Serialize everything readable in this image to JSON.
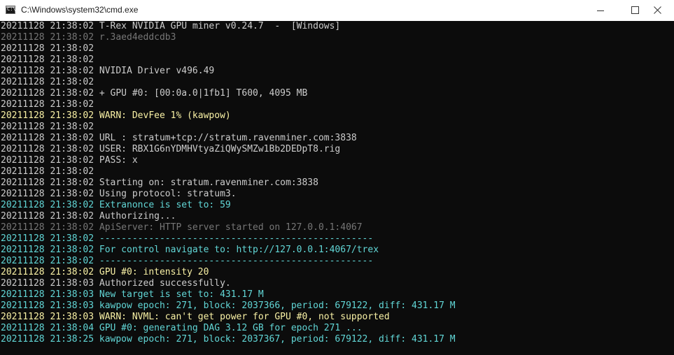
{
  "window": {
    "title": "C:\\Windows\\system32\\cmd.exe",
    "icon": "cmd-icon",
    "icon_text": "C:\\",
    "controls": [
      "minimize-icon",
      "maximize-icon",
      "close-icon"
    ]
  },
  "colors": {
    "background": "#0c0c0c",
    "default": "#cccccc",
    "dim": "#767676",
    "warn": "#f9f1a5",
    "info": "#61d6d6"
  },
  "lines": [
    {
      "text": "20211128 21:38:02 T-Rex NVIDIA GPU miner v0.24.7  -  [Windows]",
      "color": "white"
    },
    {
      "text": "20211128 21:38:02 r.3aed4eddcdb3",
      "color": "gray"
    },
    {
      "text": "20211128 21:38:02",
      "color": "white"
    },
    {
      "text": "20211128 21:38:02",
      "color": "white"
    },
    {
      "text": "20211128 21:38:02 NVIDIA Driver v496.49",
      "color": "white"
    },
    {
      "text": "20211128 21:38:02",
      "color": "white"
    },
    {
      "text": "20211128 21:38:02 + GPU #0: [00:0a.0|1fb1] T600, 4095 MB",
      "color": "white"
    },
    {
      "text": "20211128 21:38:02",
      "color": "white"
    },
    {
      "text": "20211128 21:38:02 WARN: DevFee 1% (kawpow)",
      "color": "yellow"
    },
    {
      "text": "20211128 21:38:02",
      "color": "white"
    },
    {
      "text": "20211128 21:38:02 URL : stratum+tcp://stratum.ravenminer.com:3838",
      "color": "white"
    },
    {
      "text": "20211128 21:38:02 USER: RBX1G6nYDMHVtyaZiQWySMZw1Bb2DEDpT8.rig",
      "color": "white"
    },
    {
      "text": "20211128 21:38:02 PASS: x",
      "color": "white"
    },
    {
      "text": "20211128 21:38:02",
      "color": "white"
    },
    {
      "text": "20211128 21:38:02 Starting on: stratum.ravenminer.com:3838",
      "color": "white"
    },
    {
      "text": "20211128 21:38:02 Using protocol: stratum3.",
      "color": "white"
    },
    {
      "text": "20211128 21:38:02 Extranonce is set to: 59",
      "color": "cyan2"
    },
    {
      "text": "20211128 21:38:02 Authorizing...",
      "color": "white"
    },
    {
      "text": "20211128 21:38:02 ApiServer: HTTP server started on 127.0.0.1:4067",
      "color": "gray"
    },
    {
      "text": "20211128 21:38:02 --------------------------------------------------",
      "color": "cyan2"
    },
    {
      "text": "20211128 21:38:02 For control navigate to: http://127.0.0.1:4067/trex",
      "color": "cyan2"
    },
    {
      "text": "20211128 21:38:02 --------------------------------------------------",
      "color": "cyan2"
    },
    {
      "text": "20211128 21:38:02 GPU #0: intensity 20",
      "color": "yellow"
    },
    {
      "text": "20211128 21:38:03 Authorized successfully.",
      "color": "white"
    },
    {
      "text": "20211128 21:38:03 New target is set to: 431.17 M",
      "color": "cyan2"
    },
    {
      "text": "20211128 21:38:03 kawpow epoch: 271, block: 2037366, period: 679122, diff: 431.17 M",
      "color": "cyan2"
    },
    {
      "text": "20211128 21:38:03 WARN: NVML: can't get power for GPU #0, not supported",
      "color": "yellow"
    },
    {
      "text": "20211128 21:38:04 GPU #0: generating DAG 3.12 GB for epoch 271 ...",
      "color": "cyan2"
    },
    {
      "text": "20211128 21:38:25 kawpow epoch: 271, block: 2037367, period: 679122, diff: 431.17 M",
      "color": "cyan2"
    }
  ]
}
